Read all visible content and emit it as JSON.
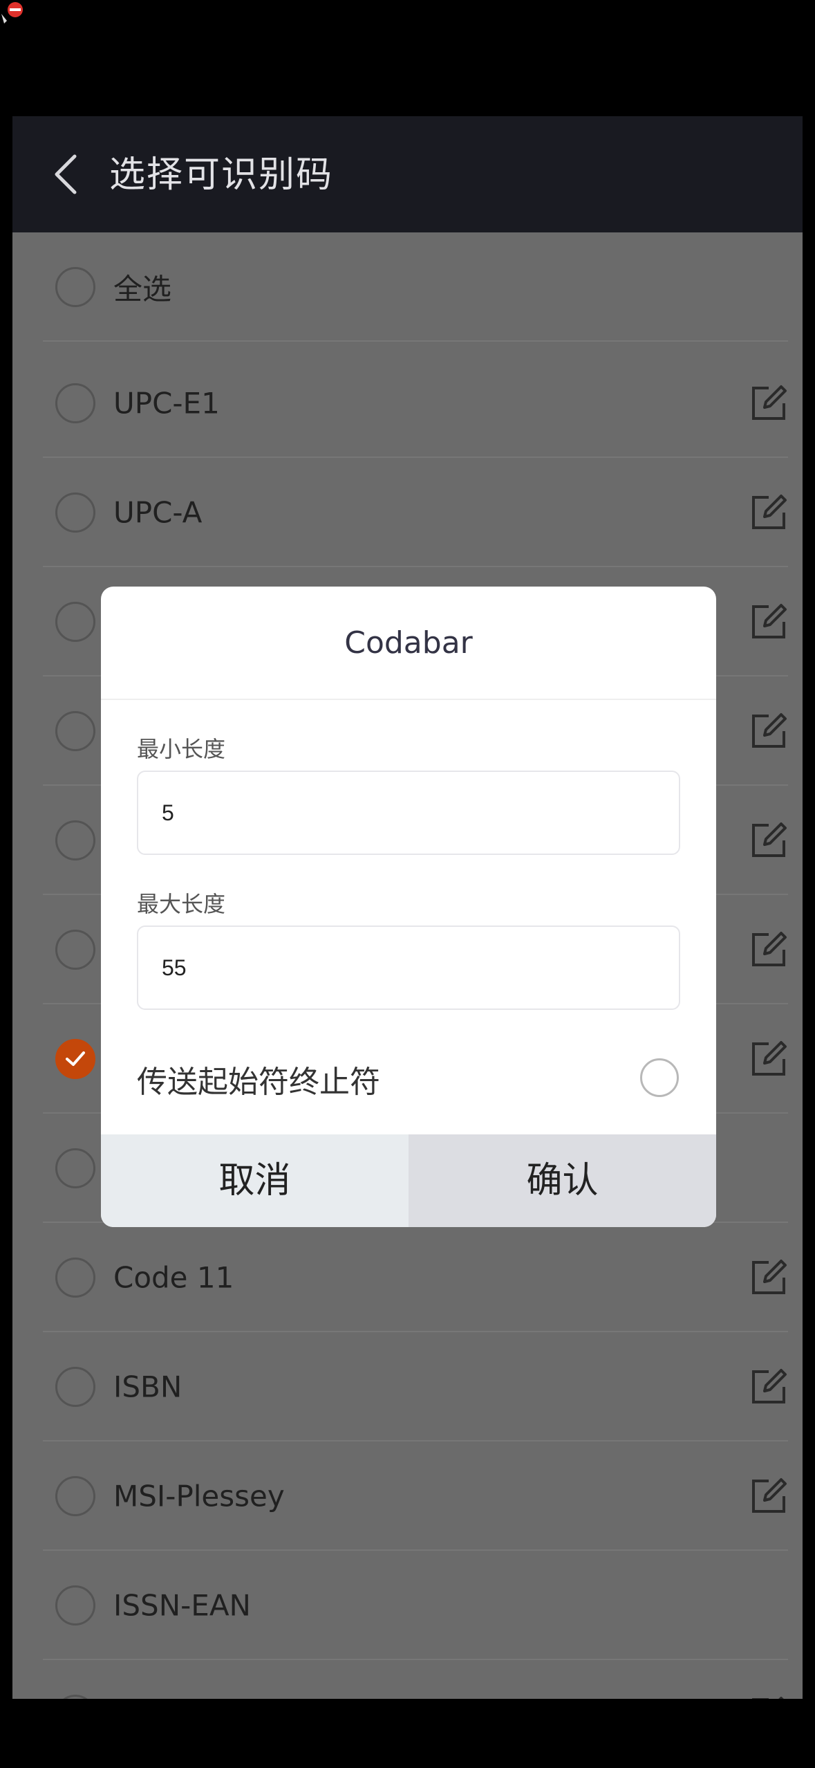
{
  "header": {
    "title": "选择可识别码"
  },
  "list": {
    "items": [
      {
        "label": "全选",
        "checked": false,
        "editable": false
      },
      {
        "label": "UPC-E1",
        "checked": false,
        "editable": true
      },
      {
        "label": "UPC-A",
        "checked": false,
        "editable": true
      },
      {
        "label": "",
        "checked": false,
        "editable": true
      },
      {
        "label": "",
        "checked": false,
        "editable": true
      },
      {
        "label": "",
        "checked": false,
        "editable": true
      },
      {
        "label": "",
        "checked": false,
        "editable": true
      },
      {
        "label": "",
        "checked": true,
        "editable": true
      },
      {
        "label": "",
        "checked": false,
        "editable": false
      },
      {
        "label": "Code 11",
        "checked": false,
        "editable": true
      },
      {
        "label": "ISBN",
        "checked": false,
        "editable": true
      },
      {
        "label": "MSI-Plessey",
        "checked": false,
        "editable": true
      },
      {
        "label": "ISSN-EAN",
        "checked": false,
        "editable": false
      },
      {
        "label": "",
        "checked": false,
        "editable": true
      }
    ]
  },
  "dialog": {
    "title": "Codabar",
    "min_length": {
      "label": "最小长度",
      "value": "5"
    },
    "max_length": {
      "label": "最大长度",
      "value": "55"
    },
    "transmit": {
      "label": "传送起始符终止符",
      "checked": false
    },
    "cancel_label": "取消",
    "confirm_label": "确认"
  },
  "colors": {
    "accent": "#c4470a",
    "header_bg": "#191a21",
    "overlay_list_bg": "#6b6b6b"
  },
  "icons": {
    "back": "chevron-left-icon",
    "edit": "edit-icon",
    "check": "check-icon"
  }
}
